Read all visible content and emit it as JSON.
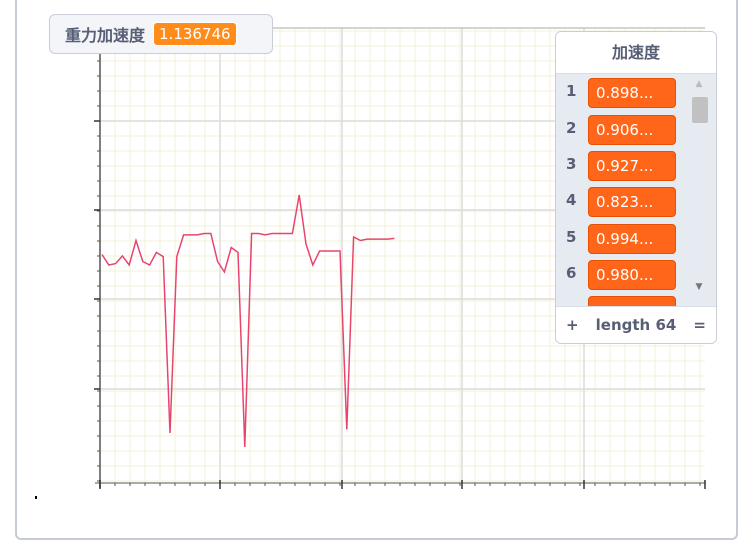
{
  "variable_monitor": {
    "label": "重力加速度",
    "value": "1.136746"
  },
  "list_monitor": {
    "title": "加速度",
    "items": [
      {
        "index": "1",
        "value": "0.898..."
      },
      {
        "index": "2",
        "value": "0.906..."
      },
      {
        "index": "3",
        "value": "0.927..."
      },
      {
        "index": "4",
        "value": "0.823..."
      },
      {
        "index": "5",
        "value": "0.994..."
      },
      {
        "index": "6",
        "value": "0.980..."
      }
    ],
    "add_label": "+",
    "length_label": "length 64",
    "resize_label": "="
  },
  "colors": {
    "line": "#e8456e",
    "list_item": "#ff661a",
    "variable_value": "#ff8c1a",
    "grid_minor": "#f2f2d8",
    "grid_major": "#dcdcdc"
  },
  "chart_data": {
    "type": "line",
    "grid": true,
    "series": [
      {
        "values": [
          0.15,
          0.0,
          0.02,
          0.13,
          0.0,
          0.35,
          0.05,
          0.0,
          0.18,
          0.12,
          -2.4,
          0.12,
          0.43,
          0.43,
          0.43,
          0.45,
          0.45,
          0.05,
          -0.1,
          0.25,
          0.18,
          -2.6,
          0.45,
          0.45,
          0.43,
          0.45,
          0.45,
          0.45,
          0.45,
          1.0,
          0.3,
          0.0,
          0.2,
          0.2,
          0.2,
          0.2,
          -2.35,
          0.4,
          0.35,
          0.37,
          0.37,
          0.37,
          0.37,
          0.38
        ]
      }
    ]
  }
}
